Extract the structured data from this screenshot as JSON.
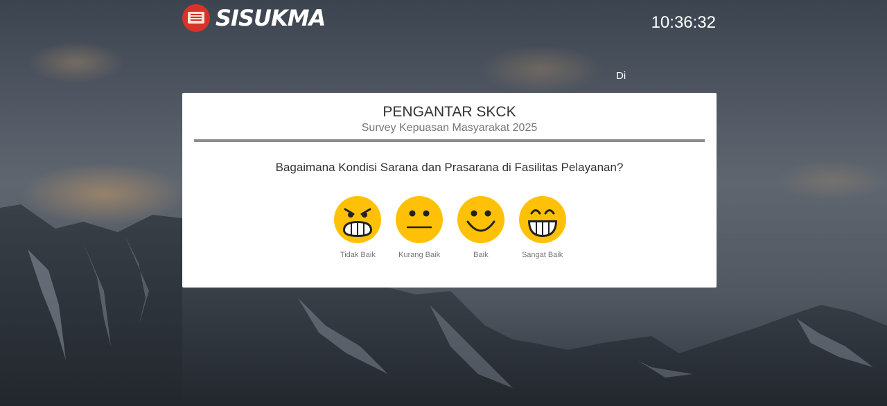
{
  "header": {
    "logo_text": "SISUKMA",
    "clock": "10:36:32",
    "marquee_text": "Di"
  },
  "survey": {
    "title": "PENGANTAR SKCK",
    "subtitle": "Survey Kepuasan Masyarakat 2025",
    "question": "Bagaimana Kondisi Sarana dan Prasarana di Fasilitas Pelayanan?",
    "options": [
      {
        "label": "Tidak Baik",
        "icon": "angry-face-icon"
      },
      {
        "label": "Kurang Baik",
        "icon": "neutral-face-icon"
      },
      {
        "label": "Baik",
        "icon": "smiling-face-icon"
      },
      {
        "label": "Sangat Baik",
        "icon": "grinning-face-icon"
      }
    ]
  },
  "colors": {
    "emoji_yellow": "#ffc107",
    "logo_red": "#d9322b",
    "divider": "#8c8c8c"
  }
}
